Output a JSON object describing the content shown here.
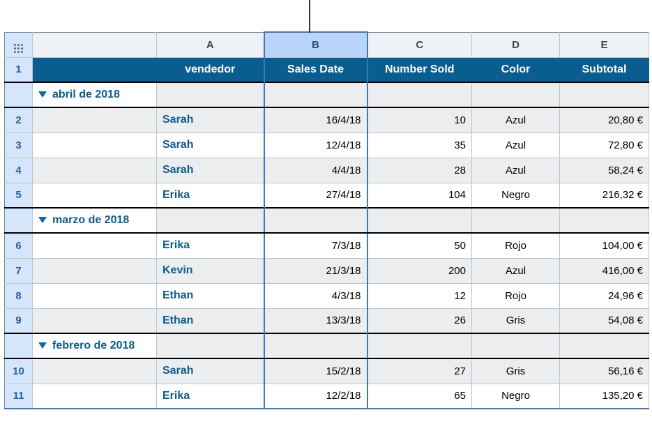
{
  "columns": {
    "letters": [
      "A",
      "B",
      "C",
      "D",
      "E"
    ],
    "selected_index": 1
  },
  "headers": {
    "vendor": "vendedor",
    "date": "Sales Date",
    "number": "Number Sold",
    "color": "Color",
    "subtotal": "Subtotal"
  },
  "groups": [
    {
      "label": "abril de 2018",
      "rows": [
        {
          "n": "2",
          "vendor": "Sarah",
          "date": "16/4/18",
          "number": "10",
          "color": "Azul",
          "subtotal": "20,80 €",
          "striped": true
        },
        {
          "n": "3",
          "vendor": "Sarah",
          "date": "12/4/18",
          "number": "35",
          "color": "Azul",
          "subtotal": "72,80 €",
          "striped": false
        },
        {
          "n": "4",
          "vendor": "Sarah",
          "date": "4/4/18",
          "number": "28",
          "color": "Azul",
          "subtotal": "58,24 €",
          "striped": true
        },
        {
          "n": "5",
          "vendor": "Erika",
          "date": "27/4/18",
          "number": "104",
          "color": "Negro",
          "subtotal": "216,32 €",
          "striped": false
        }
      ]
    },
    {
      "label": "marzo de 2018",
      "rows": [
        {
          "n": "6",
          "vendor": "Erika",
          "date": "7/3/18",
          "number": "50",
          "color": "Rojo",
          "subtotal": "104,00 €",
          "striped": false
        },
        {
          "n": "7",
          "vendor": "Kevin",
          "date": "21/3/18",
          "number": "200",
          "color": "Azul",
          "subtotal": "416,00 €",
          "striped": true
        },
        {
          "n": "8",
          "vendor": "Ethan",
          "date": "4/3/18",
          "number": "12",
          "color": "Rojo",
          "subtotal": "24,96 €",
          "striped": false
        },
        {
          "n": "9",
          "vendor": "Ethan",
          "date": "13/3/18",
          "number": "26",
          "color": "Gris",
          "subtotal": "54,08 €",
          "striped": true
        }
      ]
    },
    {
      "label": "febrero de 2018",
      "rows": [
        {
          "n": "10",
          "vendor": "Sarah",
          "date": "15/2/18",
          "number": "27",
          "color": "Gris",
          "subtotal": "56,16 €",
          "striped": true
        },
        {
          "n": "11",
          "vendor": "Erika",
          "date": "12/2/18",
          "number": "65",
          "color": "Negro",
          "subtotal": "135,20 €",
          "striped": false
        }
      ]
    }
  ],
  "header_row_number": "1"
}
